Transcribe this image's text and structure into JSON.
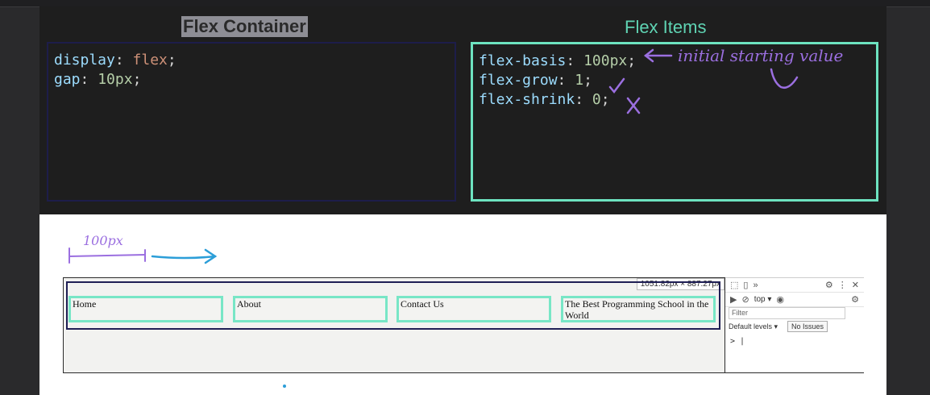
{
  "slide": {
    "container_title": "Flex Container",
    "items_title": "Flex Items",
    "container_code": [
      {
        "prop": "display",
        "value": "flex"
      },
      {
        "prop": "gap",
        "value": "10px"
      }
    ],
    "items_code": [
      {
        "prop": "flex-basis",
        "value": "100px"
      },
      {
        "prop": "flex-grow",
        "value": "1"
      },
      {
        "prop": "flex-shrink",
        "value": "0"
      }
    ],
    "annotations": {
      "basis_note": "initial starting value",
      "grow_mark": "check",
      "shrink_mark": "x",
      "width_note": "100px"
    }
  },
  "demo": {
    "size_badge": "1051.82px × 887.27px",
    "nav_items": [
      "Home",
      "About",
      "Contact Us",
      "The Best Programming School in the World"
    ]
  },
  "devtools": {
    "top_label": "top ▾",
    "filter_placeholder": "Filter",
    "levels_label": "Default levels ▾",
    "issues_label": "No Issues",
    "prompt": "> |",
    "more_label": "»"
  },
  "colors": {
    "dark_bg": "#1e1e1e",
    "accent_teal": "#6de3c0",
    "navy_border": "#1d1d4a",
    "annotation_purple": "#9b6fe0",
    "annotation_blue": "#2c9ed8"
  }
}
